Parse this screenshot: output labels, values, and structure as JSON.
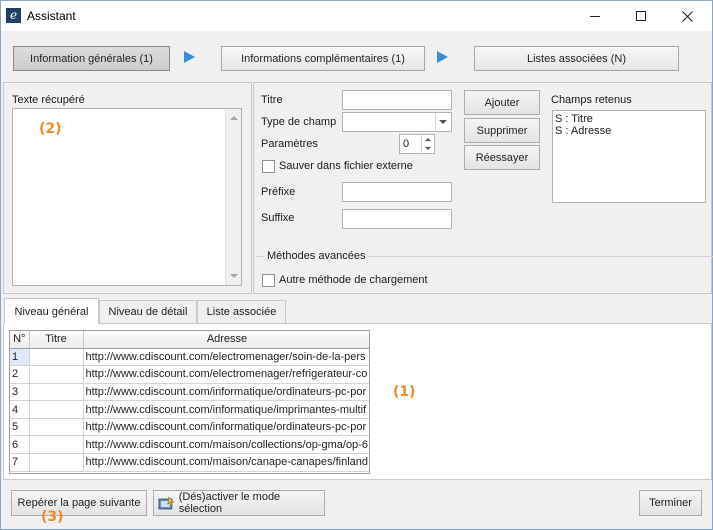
{
  "window": {
    "title": "Assistant",
    "icon": "app-e-icon"
  },
  "steps": [
    {
      "label": "Information générales (1)"
    },
    {
      "label": "Informations complémentaires (1)"
    },
    {
      "label": "Listes associées (N)"
    }
  ],
  "left_panel": {
    "title": "Texte récupéré",
    "marker": "(2)"
  },
  "form": {
    "titre_label": "Titre",
    "type_label": "Type de champ",
    "params_label": "Paramètres",
    "params_value": "0",
    "sauver_label": "Sauver dans fichier externe",
    "prefixe_label": "Préfixe",
    "suffixe_label": "Suffixe"
  },
  "actions": {
    "ajouter": "Ajouter",
    "supprimer": "Supprimer",
    "reessayer": "Réessayer"
  },
  "champs": {
    "title": "Champs retenus",
    "items": [
      "S : Titre",
      "S : Adresse"
    ]
  },
  "methodes": {
    "title": "Méthodes avancées",
    "checkbox_label": "Autre méthode de chargement"
  },
  "tabs": [
    "Niveau général",
    "Niveau de détail",
    "Liste associée"
  ],
  "grid": {
    "headers": [
      "N°",
      "Titre",
      "Adresse"
    ],
    "rows": [
      {
        "n": "1",
        "titre": "",
        "adresse": "http://www.cdiscount.com/electromenager/soin-de-la-pers"
      },
      {
        "n": "2",
        "titre": "",
        "adresse": "http://www.cdiscount.com/electromenager/refrigerateur-co"
      },
      {
        "n": "3",
        "titre": "",
        "adresse": "http://www.cdiscount.com/informatique/ordinateurs-pc-por"
      },
      {
        "n": "4",
        "titre": "",
        "adresse": "http://www.cdiscount.com/informatique/imprimantes-multif"
      },
      {
        "n": "5",
        "titre": "",
        "adresse": "http://www.cdiscount.com/informatique/ordinateurs-pc-por"
      },
      {
        "n": "6",
        "titre": "",
        "adresse": "http://www.cdiscount.com/maison/collections/op-gma/op-6"
      },
      {
        "n": "7",
        "titre": "",
        "adresse": "http://www.cdiscount.com/maison/canape-canapes/finland"
      }
    ],
    "marker": "(1)"
  },
  "footer": {
    "reperer": "Repérer la page suivante",
    "activer": "(Dés)activer le mode sélection",
    "terminer": "Terminer",
    "marker": "(3)"
  },
  "colors": {
    "accent_marker": "#f08a24",
    "step_arrow": "#3a8ad8"
  }
}
